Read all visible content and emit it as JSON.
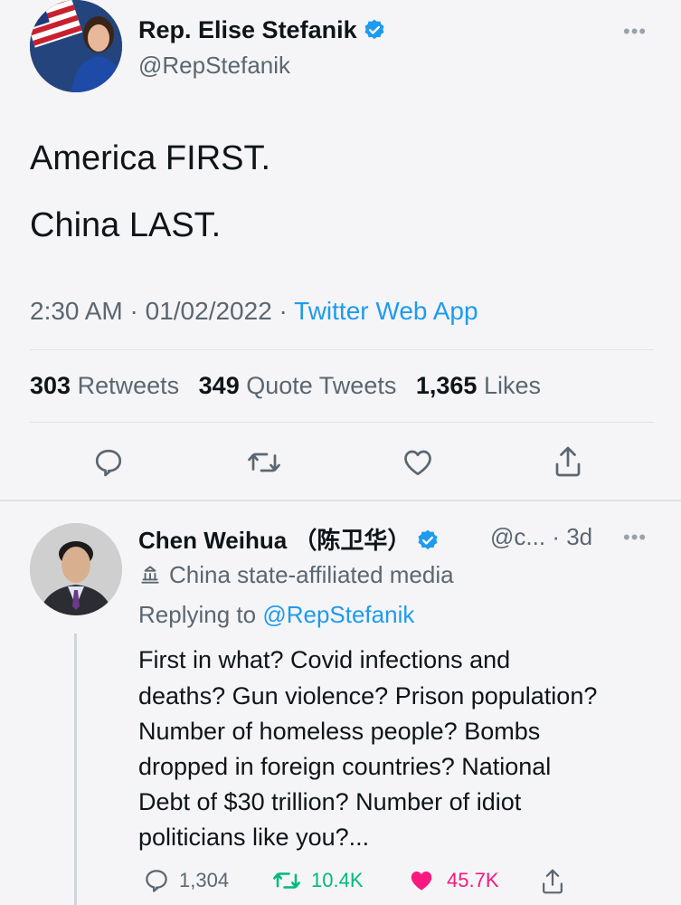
{
  "tweet": {
    "author_name": "Rep. Elise Stefanik",
    "author_handle": "@RepStefanik",
    "more_label": "•••",
    "lines": [
      "America FIRST.",
      "China LAST."
    ],
    "time": "2:30 AM",
    "date": "01/02/2022",
    "source": "Twitter Web App",
    "retweets_count": "303",
    "retweets_label": "Retweets",
    "quotes_count": "349",
    "quotes_label": "Quote Tweets",
    "likes_count": "1,365",
    "likes_label": "Likes",
    "actions": [
      "reply-icon",
      "retweet-icon",
      "like-icon",
      "share-icon"
    ]
  },
  "reply": {
    "author_name": "Chen Weihua （陈卫华）",
    "author_handle": "@c...",
    "age": "· 3d",
    "more_label": "•••",
    "affiliation": "China state-affiliated media",
    "replying_prefix": "Replying to",
    "replying_handle": "@RepStefanik",
    "lines": [
      "First in what? Covid infections and",
      "deaths? Gun violence? Prison population?",
      "Number of homeless people? Bombs",
      "dropped in foreign countries? National",
      "Debt of $30 trillion? Number of idiot",
      "politicians like you?..."
    ],
    "reply_count": "1,304",
    "retweet_count": "10.4K",
    "like_count": "45.7K"
  },
  "colors": {
    "accent": "#1d9bf0",
    "liked": "#f91880",
    "retweeted": "#00ba7c",
    "secondary_text": "#5b6670"
  }
}
